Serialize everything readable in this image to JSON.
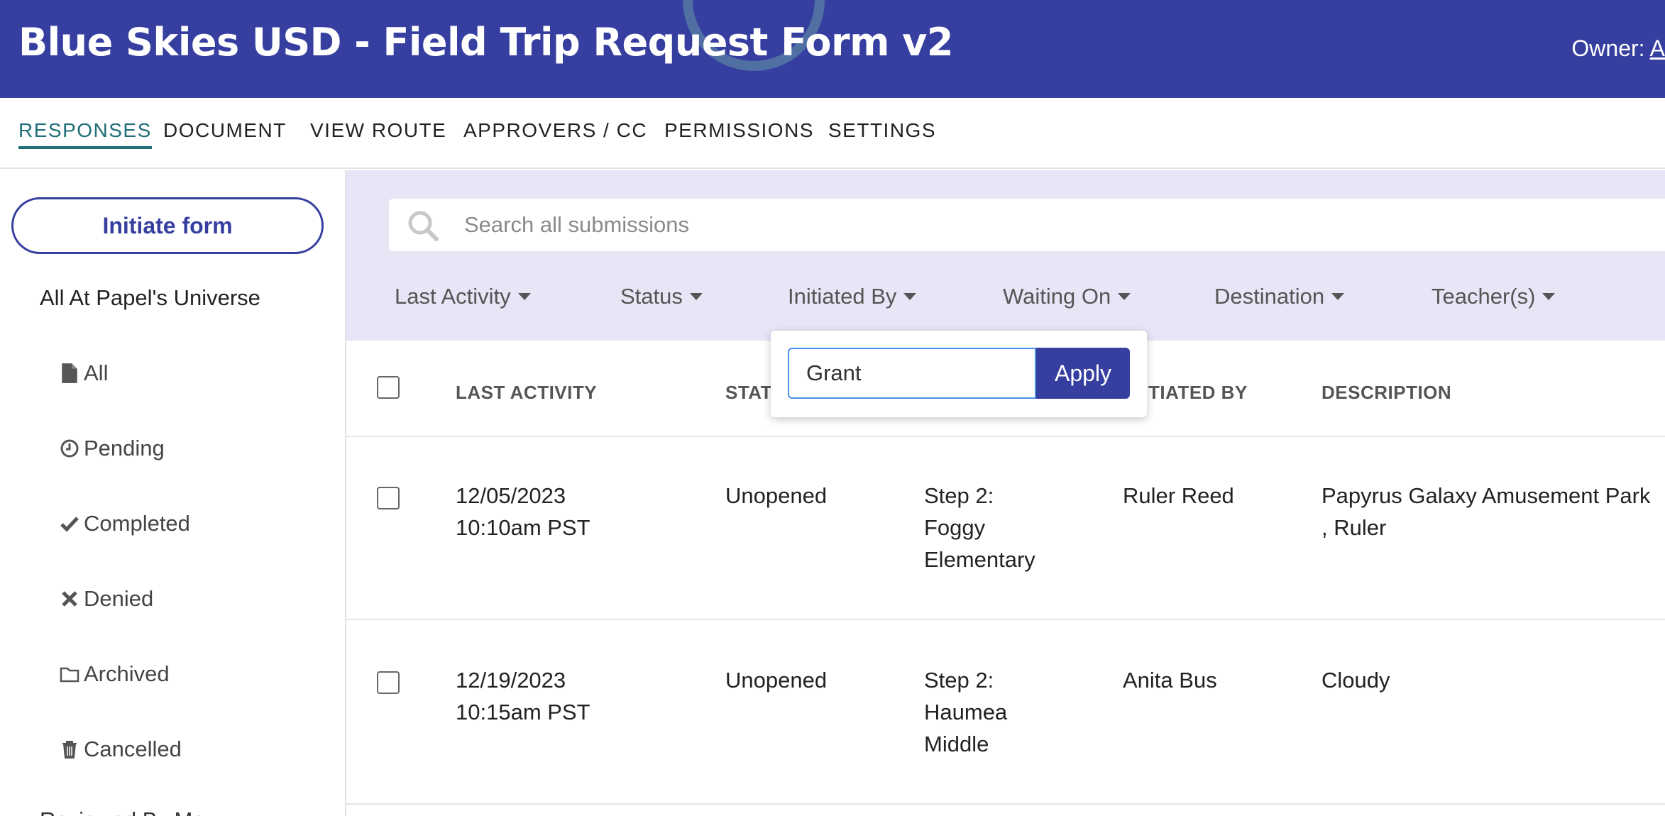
{
  "header": {
    "title": "Blue Skies USD - Field Trip Request Form v2",
    "owner_label": "Owner:",
    "owner_link": "A"
  },
  "tabs": [
    {
      "label": "RESPONSES",
      "active": true
    },
    {
      "label": "DOCUMENT"
    },
    {
      "label": "VIEW ROUTE"
    },
    {
      "label": "APPROVERS / CC"
    },
    {
      "label": "PERMISSIONS"
    },
    {
      "label": "SETTINGS"
    }
  ],
  "sidebar": {
    "initiate_label": "Initiate form",
    "universe_label": "All At Papel's Universe",
    "items": [
      {
        "label": "All",
        "icon": "file-icon"
      },
      {
        "label": "Pending",
        "icon": "clock-icon"
      },
      {
        "label": "Completed",
        "icon": "check-icon"
      },
      {
        "label": "Denied",
        "icon": "x-icon"
      },
      {
        "label": "Archived",
        "icon": "folder-icon"
      },
      {
        "label": "Cancelled",
        "icon": "trash-icon"
      }
    ],
    "cut_off_label": "Reviewed By Me"
  },
  "search": {
    "placeholder": "Search all submissions"
  },
  "filters": [
    {
      "label": "Last Activity"
    },
    {
      "label": "Status"
    },
    {
      "label": "Initiated By"
    },
    {
      "label": "Waiting On"
    },
    {
      "label": "Destination"
    },
    {
      "label": "Teacher(s)"
    }
  ],
  "popup": {
    "value": "Grant",
    "apply_label": "Apply"
  },
  "table": {
    "headers": {
      "last_activity": "LAST ACTIVITY",
      "status": "STAT",
      "initiated_by": "TIATED BY",
      "description": "DESCRIPTION"
    },
    "rows": [
      {
        "date": "12/05/2023",
        "time": "10:10am PST",
        "status": "Unopened",
        "step_1": "Step 2:",
        "step_2": "Foggy",
        "step_3": "Elementary",
        "initiated_by": "Ruler Reed",
        "desc_1": "Papyrus Galaxy Amusement Park",
        "desc_2": ", Ruler"
      },
      {
        "date": "12/19/2023",
        "time": "10:15am PST",
        "status": "Unopened",
        "step_1": "Step 2:",
        "step_2": "Haumea",
        "step_3": "Middle",
        "initiated_by": "Anita Bus",
        "desc_1": "Cloudy",
        "desc_2": ""
      }
    ]
  },
  "colors": {
    "brand": "#363fa0",
    "active_tab": "#1f6f78",
    "filter_bg": "#e6e6f7"
  }
}
